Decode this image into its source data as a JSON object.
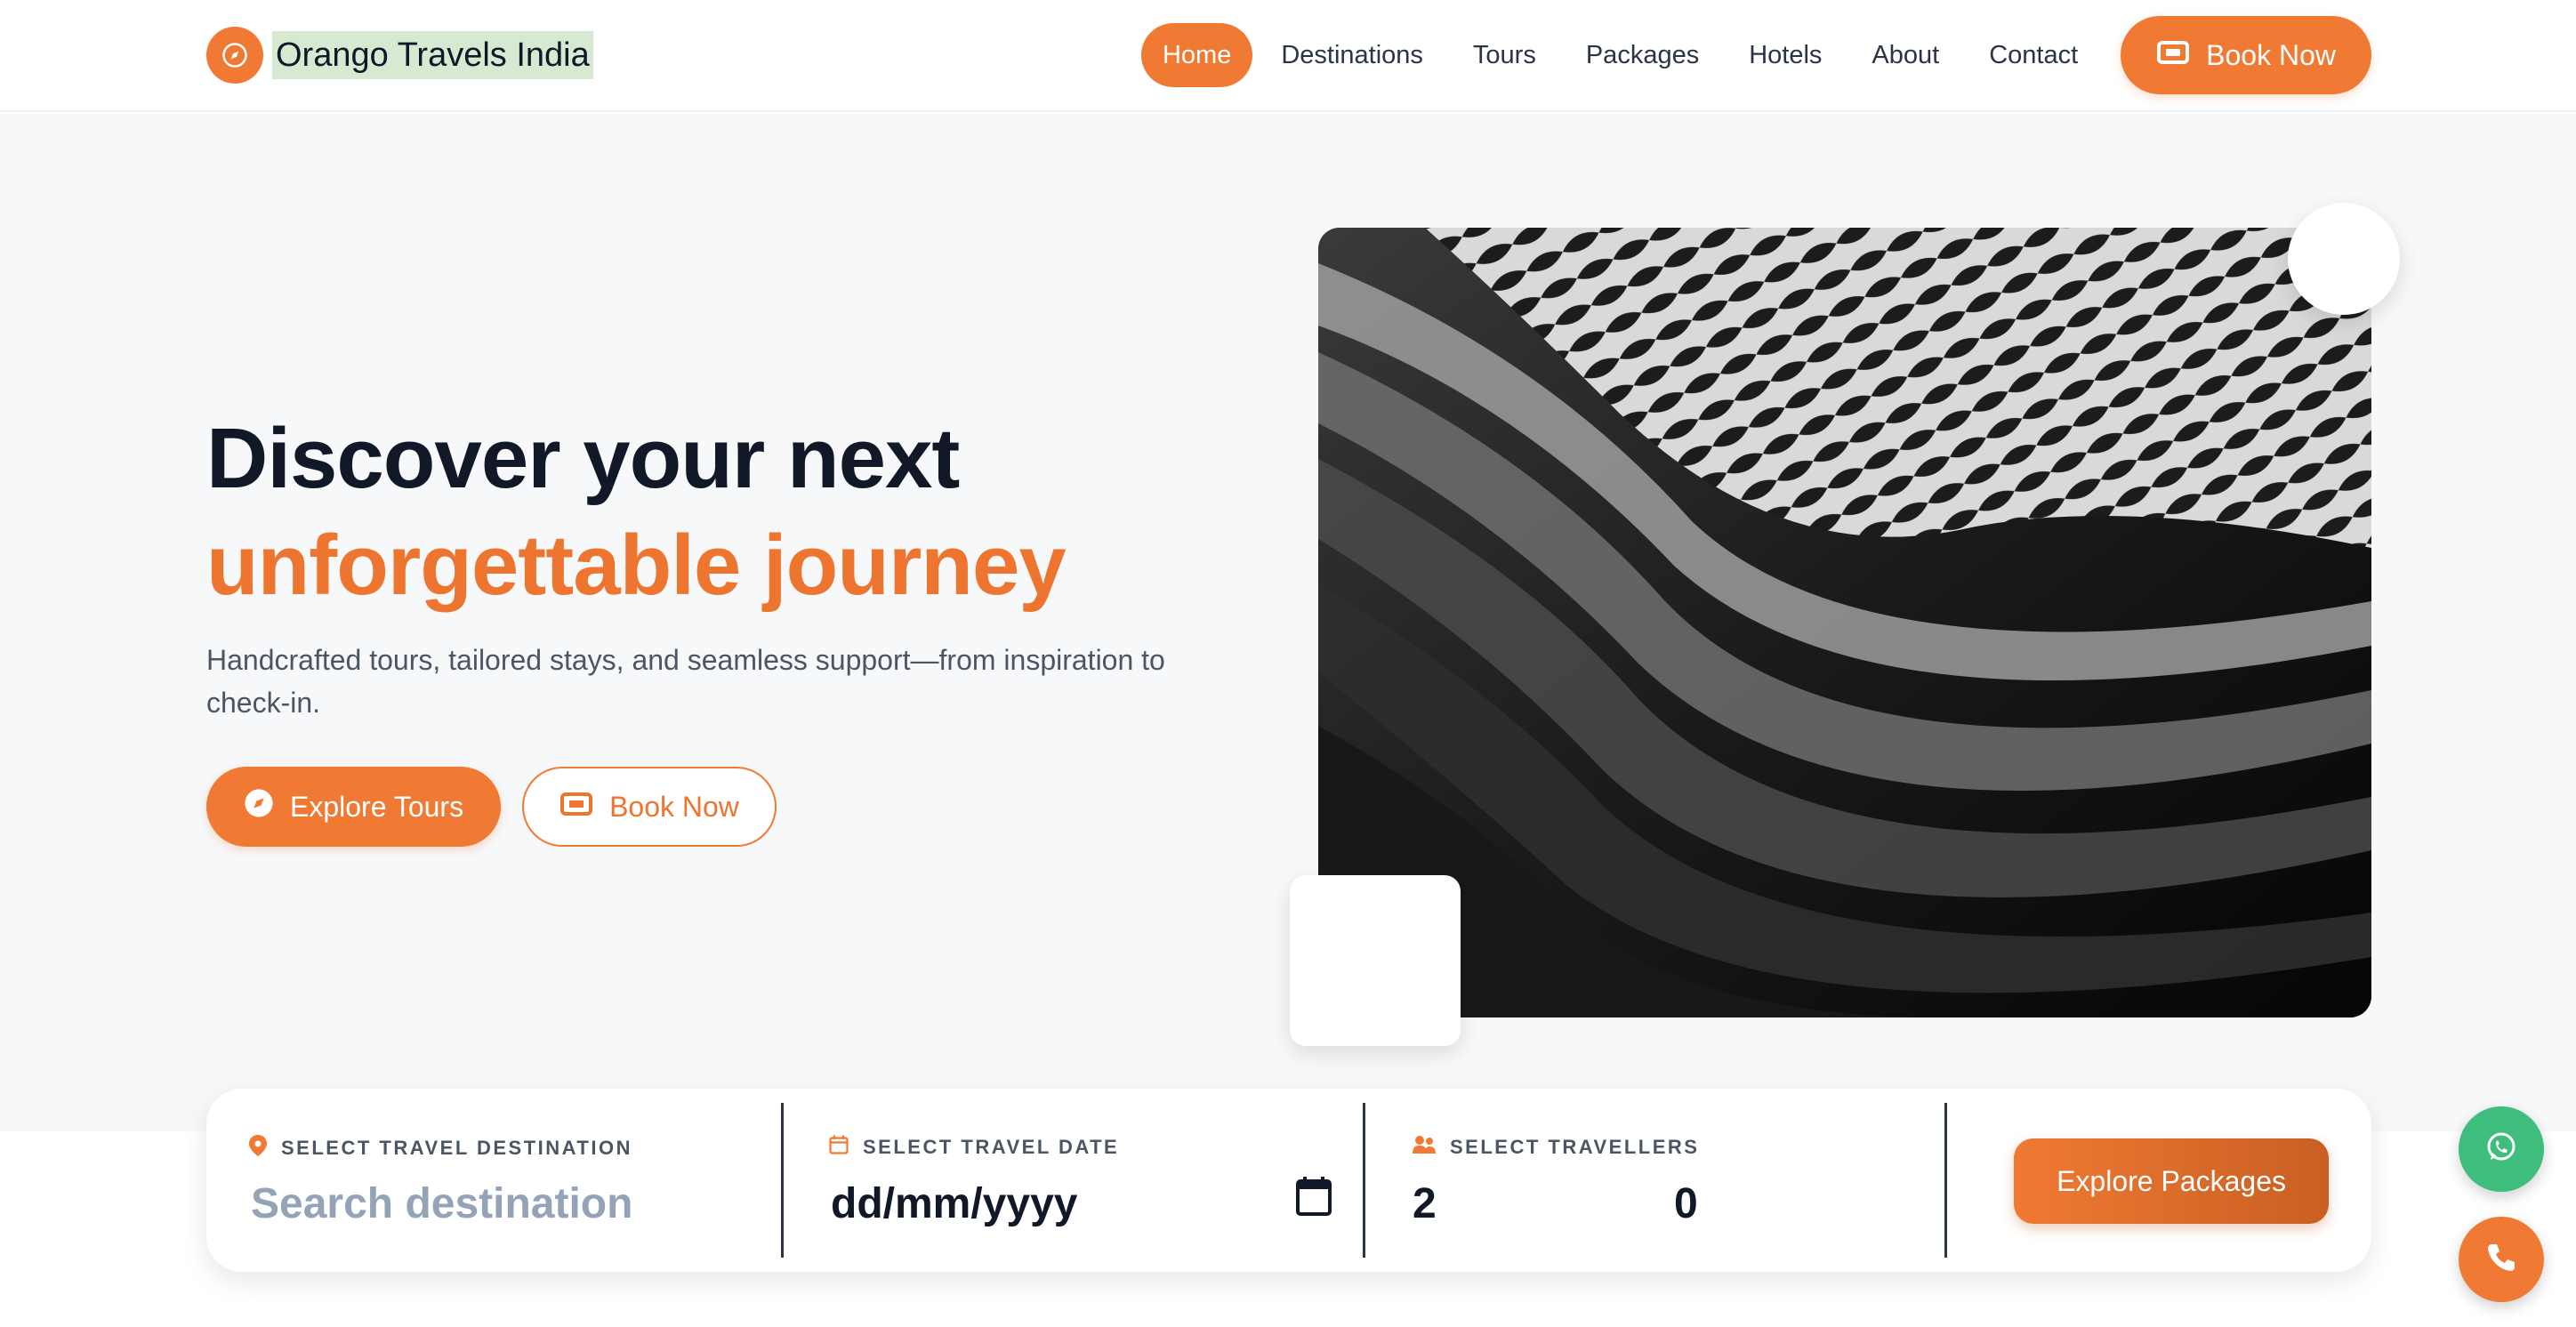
{
  "brand": {
    "name": "Orango Travels India",
    "logo_icon": "compass-icon"
  },
  "nav": {
    "items": [
      {
        "label": "Home",
        "active": true
      },
      {
        "label": "Destinations",
        "active": false
      },
      {
        "label": "Tours",
        "active": false
      },
      {
        "label": "Packages",
        "active": false
      },
      {
        "label": "Hotels",
        "active": false
      },
      {
        "label": "About",
        "active": false
      },
      {
        "label": "Contact",
        "active": false
      }
    ],
    "book_label": "Book Now",
    "book_icon": "ticket-icon"
  },
  "hero": {
    "title_line1": "Discover your next",
    "title_line2": "unforgettable journey",
    "subtitle": "Handcrafted tours, tailored stays, and seamless support—from inspiration to check-in.",
    "primary_cta": {
      "label": "Explore Tours",
      "icon": "compass-icon"
    },
    "secondary_cta": {
      "label": "Book Now",
      "icon": "ticket-icon"
    }
  },
  "search": {
    "destination": {
      "label": "SELECT TRAVEL DESTINATION",
      "placeholder": "Search destination",
      "icon": "map-pin-icon"
    },
    "date": {
      "label": "SELECT TRAVEL DATE",
      "value": "dd/mm/yyyy",
      "icon": "calendar-icon"
    },
    "travellers": {
      "label": "SELECT TRAVELLERS",
      "adults": "2",
      "children": "0",
      "icon": "users-icon"
    },
    "submit_label": "Explore Packages"
  },
  "fabs": {
    "whatsapp_icon": "whatsapp-icon",
    "call_icon": "phone-icon"
  },
  "colors": {
    "accent": "#f07a33",
    "accent_dark": "#c85f22",
    "heading": "#111827",
    "whatsapp": "#3fbd7c"
  }
}
